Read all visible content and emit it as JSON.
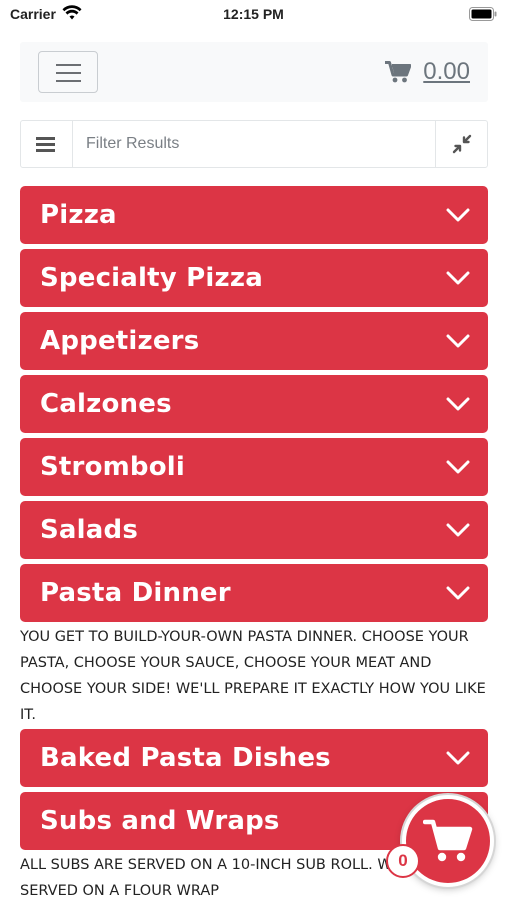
{
  "status_bar": {
    "carrier": "Carrier",
    "time": "12:15 PM"
  },
  "header": {
    "cart_total": "0.00"
  },
  "filter": {
    "placeholder": "Filter Results"
  },
  "categories": [
    {
      "label": "Pizza"
    },
    {
      "label": "Specialty Pizza"
    },
    {
      "label": "Appetizers"
    },
    {
      "label": "Calzones"
    },
    {
      "label": "Stromboli"
    },
    {
      "label": "Salads"
    },
    {
      "label": "Pasta Dinner",
      "description": "YOU GET TO BUILD-YOUR-OWN PASTA DINNER. CHOOSE YOUR PASTA, CHOOSE YOUR SAUCE, CHOOSE YOUR MEAT AND CHOOSE YOUR SIDE! WE'LL PREPARE IT EXACTLY HOW YOU LIKE IT."
    },
    {
      "label": "Baked Pasta Dishes"
    },
    {
      "label": "Subs and Wraps",
      "description": "ALL SUBS ARE SERVED ON A 10-INCH SUB ROLL. WRAPS SERVED ON A FLOUR WRAP"
    }
  ],
  "floating_cart": {
    "count": "0"
  },
  "colors": {
    "accent": "#dc3545",
    "navbar": "#f8f9fa"
  },
  "icons": [
    "wifi-icon",
    "battery-icon",
    "hamburger-icon",
    "cart-icon",
    "list-icon",
    "collapse-icon",
    "chevron-down-icon"
  ]
}
